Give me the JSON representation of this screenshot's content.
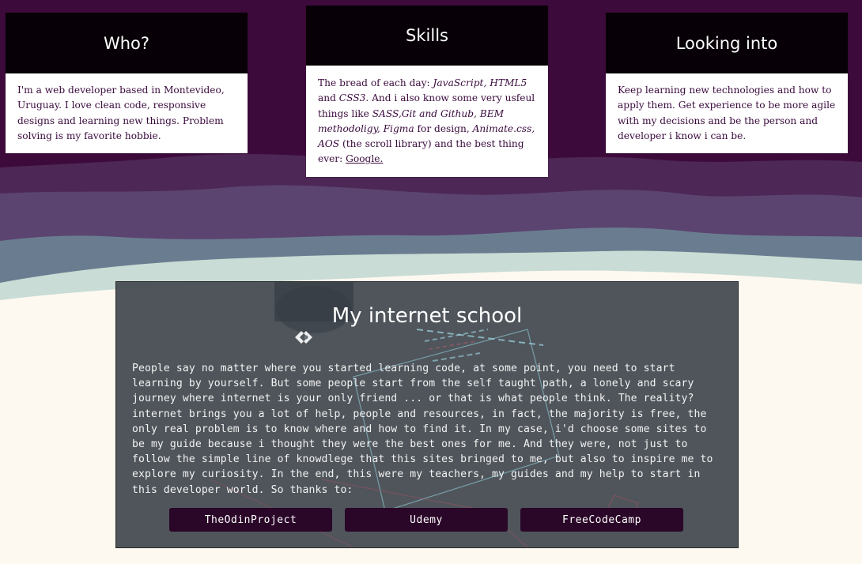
{
  "cards": {
    "who": {
      "title": "Who?",
      "body": "I'm a web developer based in Montevideo, Uruguay. I love clean code, responsive designs and learning new things. Problem solving is my favorite hobbie."
    },
    "skills": {
      "title": "Skills",
      "intro": "The bread of each day: ",
      "js": "JavaScript",
      "sep1": ", ",
      "html": "HTML5",
      "and1": " and ",
      "css": "CSS3.",
      "mid": " And i also know some very usfeul things like ",
      "tools": "SASS,Git and Github, BEM methodoligy, Figma",
      "for_design": " for design, ",
      "anim": "Animate.css, AOS",
      "tail": " (the scroll library) and the best thing ever: ",
      "google": "Google."
    },
    "looking": {
      "title": "Looking into",
      "body": "Keep learning new technologies and how to apply them. Get experience to be more agile with my decisions and be the person and developer i know i can be."
    }
  },
  "school": {
    "title": "My internet school",
    "text": "People say no matter where you started learning code, at some point, you need to start learning by yourself. But some people start from the self taught path, a lonely and scary journey where internet is your only friend ... or that is what people think. The reality? internet brings you a lot of help, people and resources, in fact, the majority is free, the only real problem is to know where and how to find it. In my case, i'd choose some sites to be my guide because i thought they were the best ones for me. And they were, not just to follow the simple line of knowdlege that this sites bringed to me, but also to inspire me to explore my curiosity. In the end, this were my teachers, my guides and my help to start in this developer world. So thanks to:",
    "buttons": [
      "TheOdinProject",
      "Udemy",
      "FreeCodeCamp"
    ]
  },
  "colors": {
    "header_bg": "#070006",
    "text_purple": "#3a0a3d",
    "button_bg": "#2a0628",
    "wave_dark": "#3d0b3b",
    "page_bg": "#fdf9f1"
  }
}
